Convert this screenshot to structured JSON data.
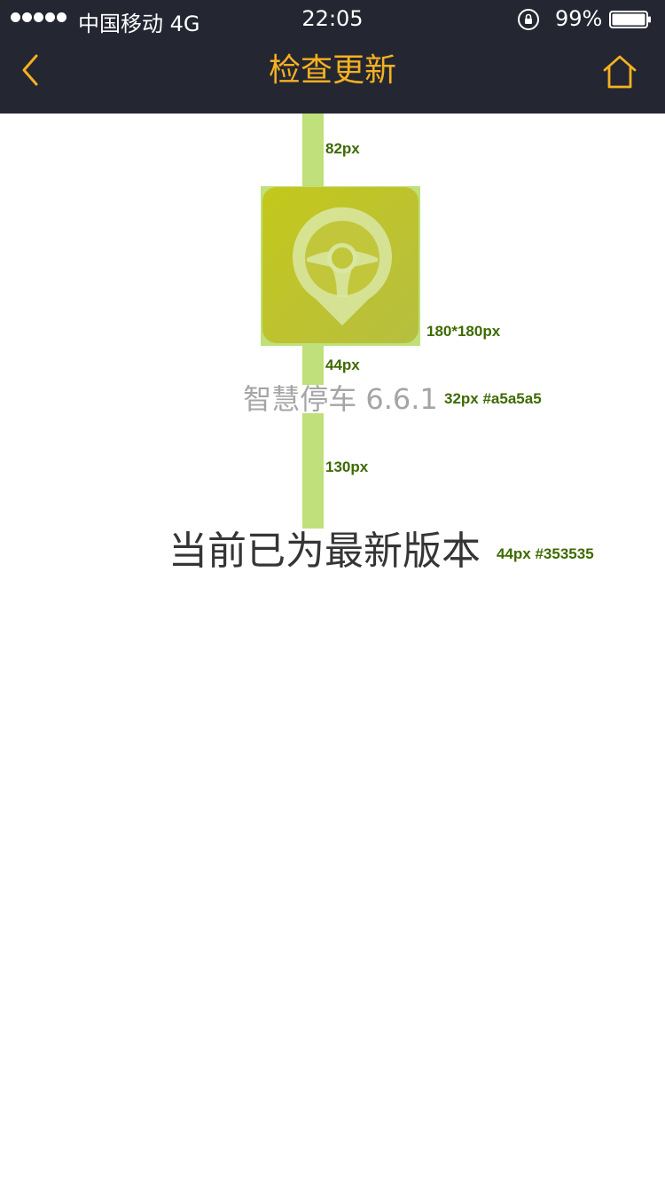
{
  "status_bar": {
    "carrier": "中国移动  4G",
    "time": "22:05",
    "battery_percent": "99%"
  },
  "nav": {
    "title": "检查更新",
    "back_icon": "chevron-left-icon",
    "home_icon": "home-icon"
  },
  "app": {
    "name_version": "智慧停车  6.6.1",
    "icon": "steering-wheel-pin-icon"
  },
  "message": "当前已为最新版本",
  "annotations": {
    "top_gap": "82px",
    "icon_size": "180*180px",
    "icon_gap": "44px",
    "name_spec": "32px #a5a5a5",
    "message_gap": "130px",
    "message_spec": "44px #353535"
  },
  "colors": {
    "nav_background": "#242732",
    "accent": "#f5b120",
    "app_name": "#a5a5a5",
    "message": "#353535",
    "annotation_bar": "#bfe07a",
    "annotation_text": "#3d6a00"
  }
}
